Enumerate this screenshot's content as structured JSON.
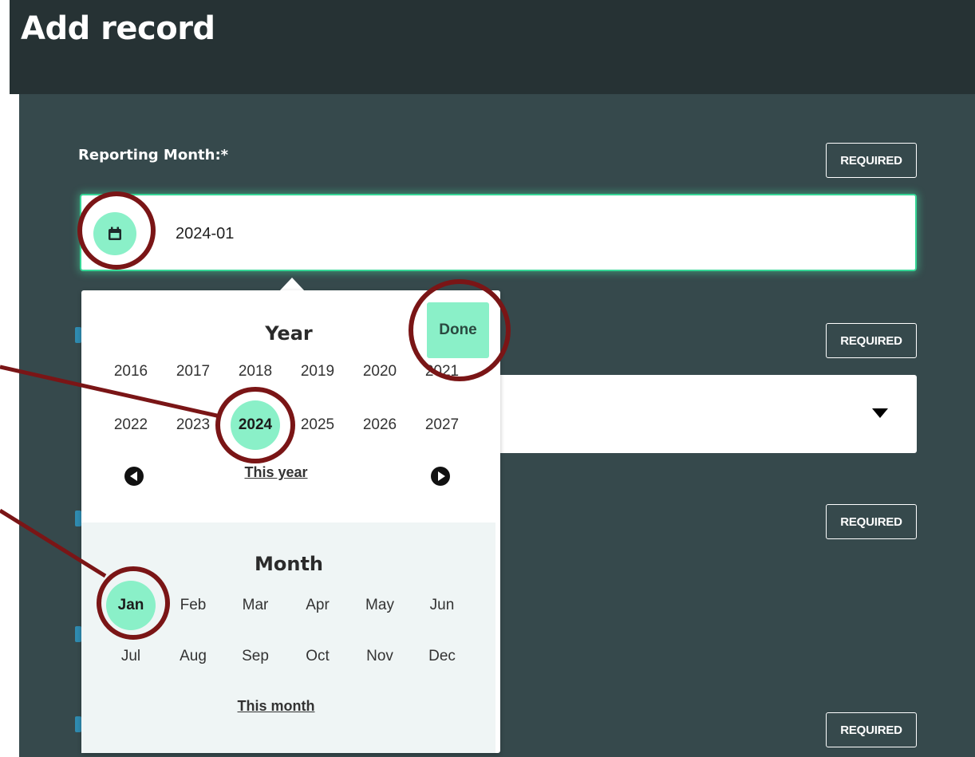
{
  "page": {
    "title": "Add record"
  },
  "form": {
    "reporting_month_label": "Reporting Month:*",
    "reporting_month_value": "2024-01",
    "required_badge": "REQUIRED"
  },
  "picker": {
    "year_title": "Year",
    "done_label": "Done",
    "years": [
      "2016",
      "2017",
      "2018",
      "2019",
      "2020",
      "2021",
      "2022",
      "2023",
      "2024",
      "2025",
      "2026",
      "2027"
    ],
    "selected_year": "2024",
    "this_year_label": "This year",
    "month_title": "Month",
    "months": [
      "Jan",
      "Feb",
      "Mar",
      "Apr",
      "May",
      "Jun",
      "Jul",
      "Aug",
      "Sep",
      "Oct",
      "Nov",
      "Dec"
    ],
    "selected_month": "Jan",
    "this_month_label": "This month"
  },
  "colors": {
    "header_bg": "#263234",
    "panel_bg": "#36494c",
    "accent": "#8af0c8",
    "focus_border": "#36d696",
    "annotation": "#7a1516"
  },
  "icons": {
    "calendar": "calendar-icon",
    "prev": "prev-year-page-icon",
    "next": "next-year-page-icon",
    "dropdown": "dropdown-arrow-icon"
  }
}
